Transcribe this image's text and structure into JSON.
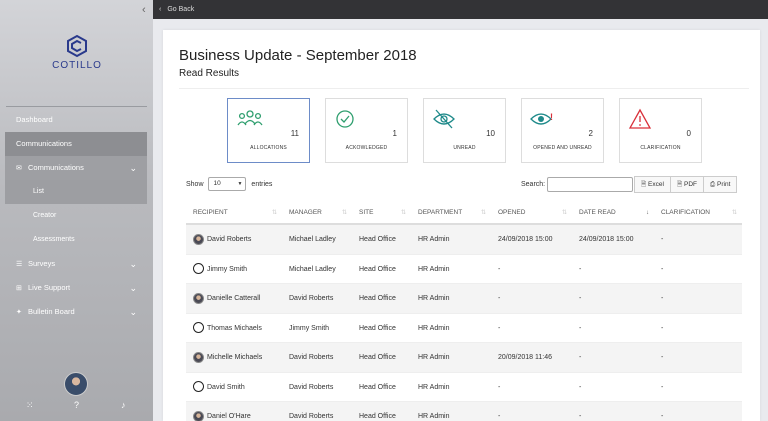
{
  "sidebar": {
    "collapse_icon": "chevron-left-icon",
    "logo_text": "COTILLO",
    "nav": [
      {
        "label": "Dashboard"
      },
      {
        "label": "Communications"
      },
      {
        "label": "Communications"
      },
      {
        "label": "List"
      },
      {
        "label": "Creator"
      },
      {
        "label": "Assessments"
      },
      {
        "label": "Surveys"
      },
      {
        "label": "Live Support"
      },
      {
        "label": "Bulletin Board"
      }
    ],
    "bottom_help": "?"
  },
  "topbar": {
    "back_label": "Go Back"
  },
  "page": {
    "title": "Business Update - September 2018",
    "subtitle": "Read Results"
  },
  "stats": [
    {
      "value": "11",
      "label": "ALLOCATIONS",
      "icon": "users-icon",
      "color": "#2e9e6e"
    },
    {
      "value": "1",
      "label": "ACKOWLEDGED",
      "icon": "check-circle-icon",
      "color": "#2e9e6e"
    },
    {
      "value": "10",
      "label": "UNREAD",
      "icon": "eye-slash-icon",
      "color": "#1f8a8a"
    },
    {
      "value": "2",
      "label": "OPENED AND UNREAD",
      "icon": "eye-alert-icon",
      "color": "#1f8a8a"
    },
    {
      "value": "0",
      "label": "CLARIFICATION",
      "icon": "warning-icon",
      "color": "#d9303a"
    }
  ],
  "controls": {
    "show_label": "Show",
    "entries_value": "10",
    "entries_label": "entries",
    "search_label": "Search:",
    "search_value": "",
    "excel_label": "Excel",
    "pdf_label": "PDF",
    "print_label": "Print"
  },
  "table": {
    "columns": [
      "RECIPIENT",
      "MANAGER",
      "SITE",
      "DEPARTMENT",
      "OPENED",
      "DATE READ",
      "CLARIFICATION"
    ],
    "rows": [
      {
        "recipient": "David Roberts",
        "manager": "Michael Ladley",
        "site": "Head Office",
        "department": "HR Admin",
        "opened": "24/09/2018 15:00",
        "date_read": "24/09/2018 15:00",
        "clarification": "-",
        "avatar": "photo"
      },
      {
        "recipient": "Jimmy Smith",
        "manager": "Michael Ladley",
        "site": "Head Office",
        "department": "HR Admin",
        "opened": "-",
        "date_read": "-",
        "clarification": "-",
        "avatar": "blank"
      },
      {
        "recipient": "Danielle Catterall",
        "manager": "David Roberts",
        "site": "Head Office",
        "department": "HR Admin",
        "opened": "-",
        "date_read": "-",
        "clarification": "-",
        "avatar": "photo"
      },
      {
        "recipient": "Thomas Michaels",
        "manager": "Jimmy Smith",
        "site": "Head Office",
        "department": "HR Admin",
        "opened": "-",
        "date_read": "-",
        "clarification": "-",
        "avatar": "blank"
      },
      {
        "recipient": "Michelle Michaels",
        "manager": "David Roberts",
        "site": "Head Office",
        "department": "HR Admin",
        "opened": "20/09/2018 11:46",
        "date_read": "-",
        "clarification": "-",
        "avatar": "photo"
      },
      {
        "recipient": "David Smith",
        "manager": "David Roberts",
        "site": "Head Office",
        "department": "HR Admin",
        "opened": "-",
        "date_read": "-",
        "clarification": "-",
        "avatar": "blank"
      },
      {
        "recipient": "Daniel O'Hare",
        "manager": "David Roberts",
        "site": "Head Office",
        "department": "HR Admin",
        "opened": "-",
        "date_read": "-",
        "clarification": "-",
        "avatar": "photo"
      }
    ]
  }
}
